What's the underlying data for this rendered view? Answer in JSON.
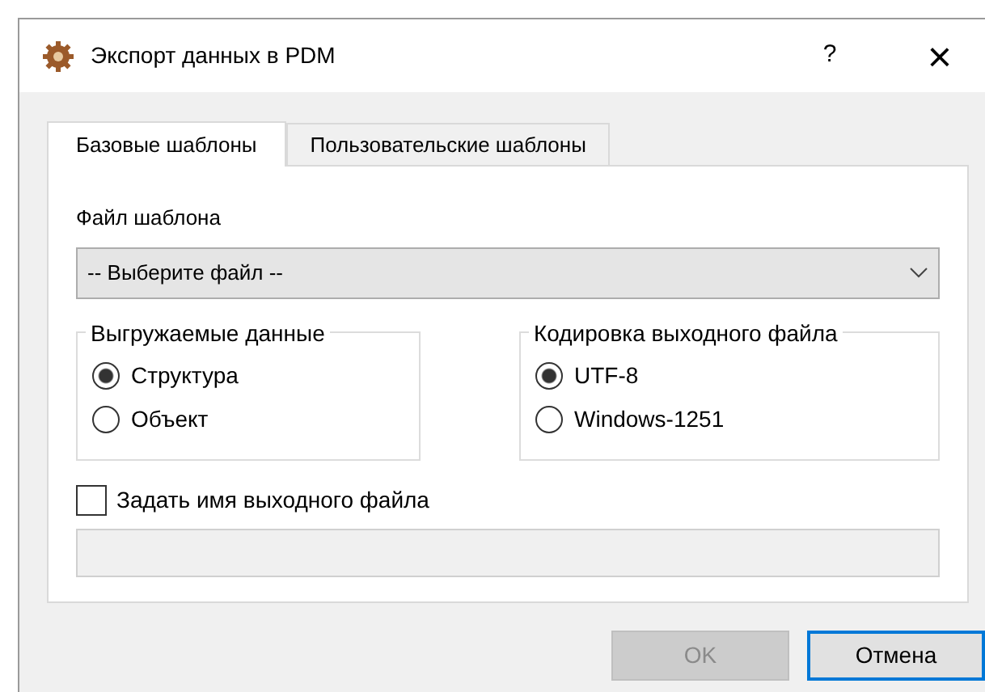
{
  "window": {
    "title": "Экспорт данных в PDM",
    "help": "?",
    "close": "×"
  },
  "tabs": [
    {
      "label": "Базовые шаблоны",
      "selected": true
    },
    {
      "label": "Пользовательские шаблоны",
      "selected": false
    }
  ],
  "template_file": {
    "label": "Файл шаблона",
    "value": "-- Выберите файл --"
  },
  "groups": [
    {
      "title": "Выгружаемые данные",
      "options": [
        {
          "label": "Структура",
          "selected": true
        },
        {
          "label": "Объект",
          "selected": false
        }
      ]
    },
    {
      "title": "Кодировка выходного файла",
      "options": [
        {
          "label": "UTF-8",
          "selected": true
        },
        {
          "label": "Windows-1251",
          "selected": false
        }
      ]
    }
  ],
  "output_name": {
    "label": "Задать имя выходного файла",
    "checked": false,
    "disabled": true
  },
  "buttons": [
    {
      "label": "OK",
      "disabled": true,
      "default": false
    },
    {
      "label": "Отмена",
      "disabled": false,
      "default": true
    }
  ]
}
